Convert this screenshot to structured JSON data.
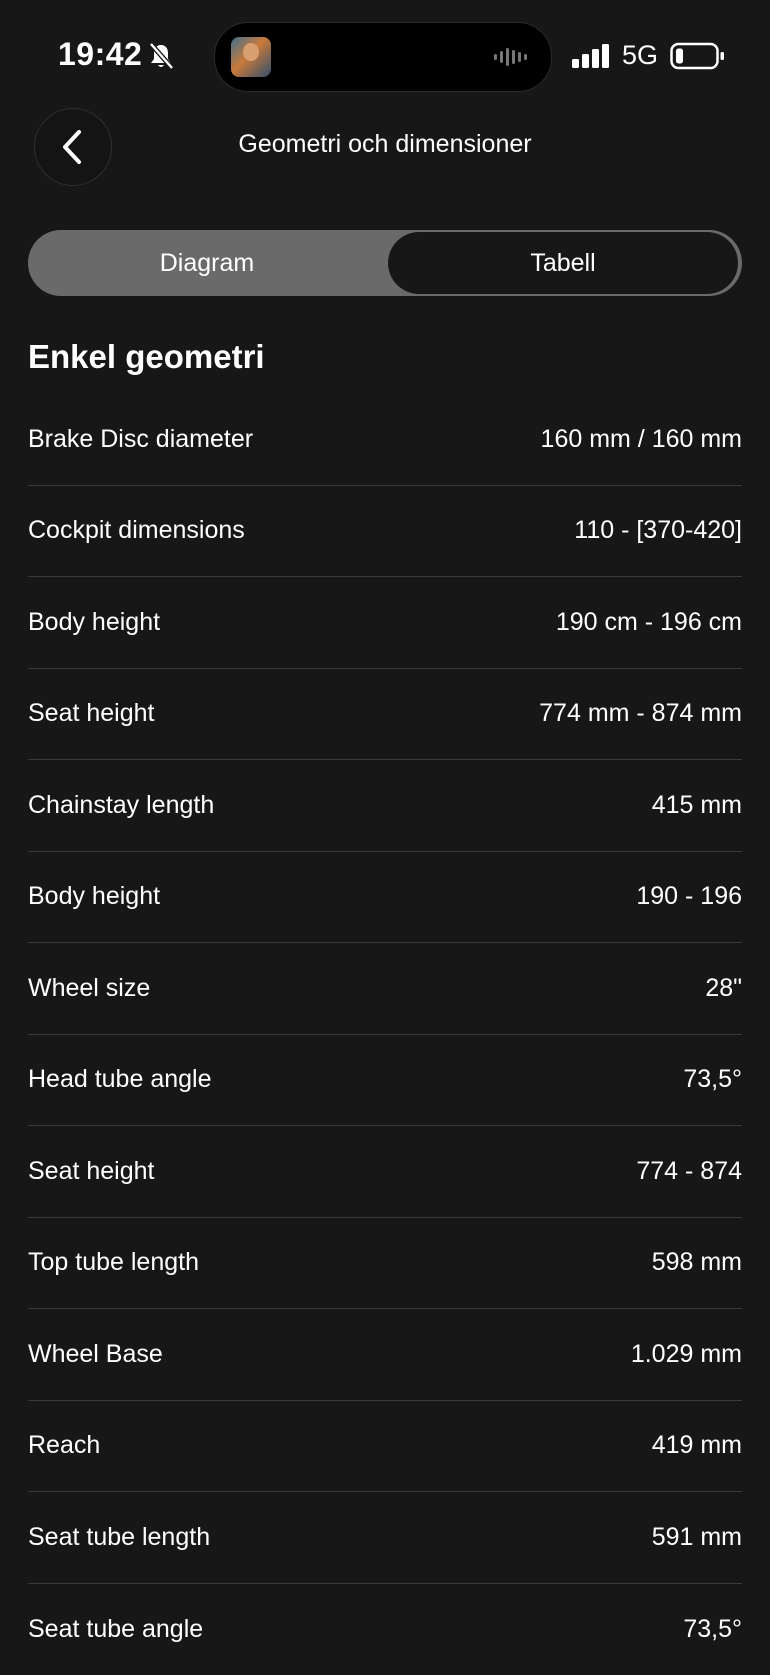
{
  "status_bar": {
    "time": "19:42",
    "network": "5G"
  },
  "header": {
    "title": "Geometri och dimensioner"
  },
  "tabs": [
    {
      "label": "Diagram",
      "selected": false
    },
    {
      "label": "Tabell",
      "selected": true
    }
  ],
  "section": {
    "title": "Enkel geometri"
  },
  "rows": [
    {
      "label": "Brake Disc diameter",
      "value": "160 mm / 160 mm"
    },
    {
      "label": "Cockpit dimensions",
      "value": "110 - [370-420]"
    },
    {
      "label": "Body height",
      "value": "190 cm - 196 cm"
    },
    {
      "label": "Seat height",
      "value": "774 mm - 874 mm"
    },
    {
      "label": "Chainstay length",
      "value": "415 mm"
    },
    {
      "label": "Body height",
      "value": "190 - 196"
    },
    {
      "label": "Wheel size",
      "value": "28\""
    },
    {
      "label": "Head tube angle",
      "value": "73,5°"
    },
    {
      "label": "Seat height",
      "value": "774 - 874"
    },
    {
      "label": "Top tube length",
      "value": "598 mm"
    },
    {
      "label": "Wheel Base",
      "value": "1.029 mm"
    },
    {
      "label": "Reach",
      "value": "419 mm"
    },
    {
      "label": "Seat tube length",
      "value": "591 mm"
    },
    {
      "label": "Seat tube angle",
      "value": "73,5°"
    }
  ],
  "icons": {
    "back": "chevron-left-icon",
    "silent": "bell-slash-icon",
    "signal": "cellular-signal-icon",
    "battery": "battery-low-icon",
    "waveform": "audio-waveform-icon"
  },
  "colors": {
    "background": "#171717",
    "segment_track": "#6a6a6a",
    "divider": "#3a3a3a",
    "text": "#ffffff"
  }
}
